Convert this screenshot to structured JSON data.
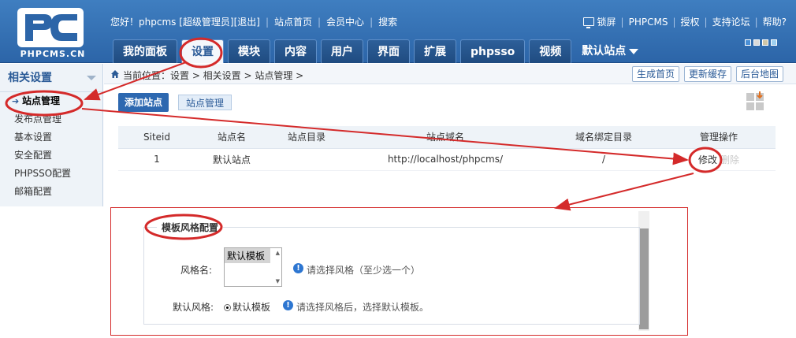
{
  "header": {
    "logo_text": "PHPCMS.CN",
    "greeting": "您好！phpcms [超级管理员]",
    "logout": "[退出]",
    "site_home": "站点首页",
    "member_center": "会员中心",
    "search": "搜索",
    "lock_screen": "锁屏",
    "phpcms": "PHPCMS",
    "license": "授权",
    "forum": "支持论坛",
    "help": "帮助?"
  },
  "nav": {
    "tabs": [
      {
        "label": "我的面板"
      },
      {
        "label": "设置"
      },
      {
        "label": "模块"
      },
      {
        "label": "内容"
      },
      {
        "label": "用户"
      },
      {
        "label": "界面"
      },
      {
        "label": "扩展"
      },
      {
        "label": "phpsso"
      },
      {
        "label": "视频"
      }
    ],
    "site_select": "默认站点"
  },
  "sidebar": {
    "title": "相关设置",
    "items": [
      {
        "label": "站点管理"
      },
      {
        "label": "发布点管理"
      },
      {
        "label": "基本设置"
      },
      {
        "label": "安全配置"
      },
      {
        "label": "PHPSSO配置"
      },
      {
        "label": "邮箱配置"
      }
    ]
  },
  "breadcrumb": {
    "text": "当前位置：设置 > 相关设置 > 站点管理 >",
    "actions": [
      "生成首页",
      "更新缓存",
      "后台地图"
    ]
  },
  "actions": {
    "add_site": "添加站点",
    "manage_site": "站点管理"
  },
  "table": {
    "headers": [
      "Siteid",
      "站点名",
      "站点目录",
      "站点域名",
      "域名绑定目录",
      "管理操作"
    ],
    "rows": [
      {
        "siteid": "1",
        "name": "默认站点",
        "dir": "",
        "domain": "http://localhost/phpcms/",
        "bind_dir": "/",
        "edit": "修改",
        "delete": "删除"
      }
    ]
  },
  "template_panel": {
    "legend": "模板风格配置",
    "style_label": "风格名:",
    "style_option": "默认模板",
    "style_hint": "请选择风格（至少选一个）",
    "default_label": "默认风格:",
    "default_option": "默认模板",
    "default_hint": "请选择风格后，选择默认模板。"
  },
  "colors": {
    "header_blue": "#3f7ec0",
    "annotation_red": "#d42a2a",
    "button_blue": "#2d68b0"
  }
}
